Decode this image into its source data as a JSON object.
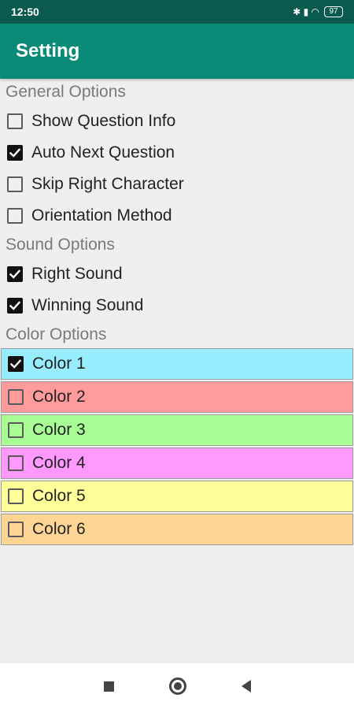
{
  "status_bar": {
    "time": "12:50",
    "icons": "✱ ▮ ◠",
    "battery": "97"
  },
  "app_bar": {
    "title": "Setting"
  },
  "general": {
    "title": "General Options",
    "items": [
      {
        "label": "Show Question Info",
        "checked": false
      },
      {
        "label": "Auto Next Question",
        "checked": true
      },
      {
        "label": "Skip Right Character",
        "checked": false
      },
      {
        "label": "Orientation Method",
        "checked": false
      }
    ]
  },
  "sound": {
    "title": "Sound Options",
    "items": [
      {
        "label": "Right Sound",
        "checked": true
      },
      {
        "label": "Winning Sound",
        "checked": true
      }
    ]
  },
  "color": {
    "title": "Color Options",
    "items": [
      {
        "label": "Color 1",
        "checked": true,
        "bg": "#97ecfe"
      },
      {
        "label": "Color 2",
        "checked": false,
        "bg": "#ff9b9b"
      },
      {
        "label": "Color 3",
        "checked": false,
        "bg": "#a8fe95"
      },
      {
        "label": "Color 4",
        "checked": false,
        "bg": "#ff99ff"
      },
      {
        "label": "Color 5",
        "checked": false,
        "bg": "#ffff99"
      },
      {
        "label": "Color 6",
        "checked": false,
        "bg": "#ffd596"
      }
    ]
  },
  "nav_bar": {
    "icons": [
      "recents-icon",
      "home-icon",
      "back-icon"
    ]
  }
}
